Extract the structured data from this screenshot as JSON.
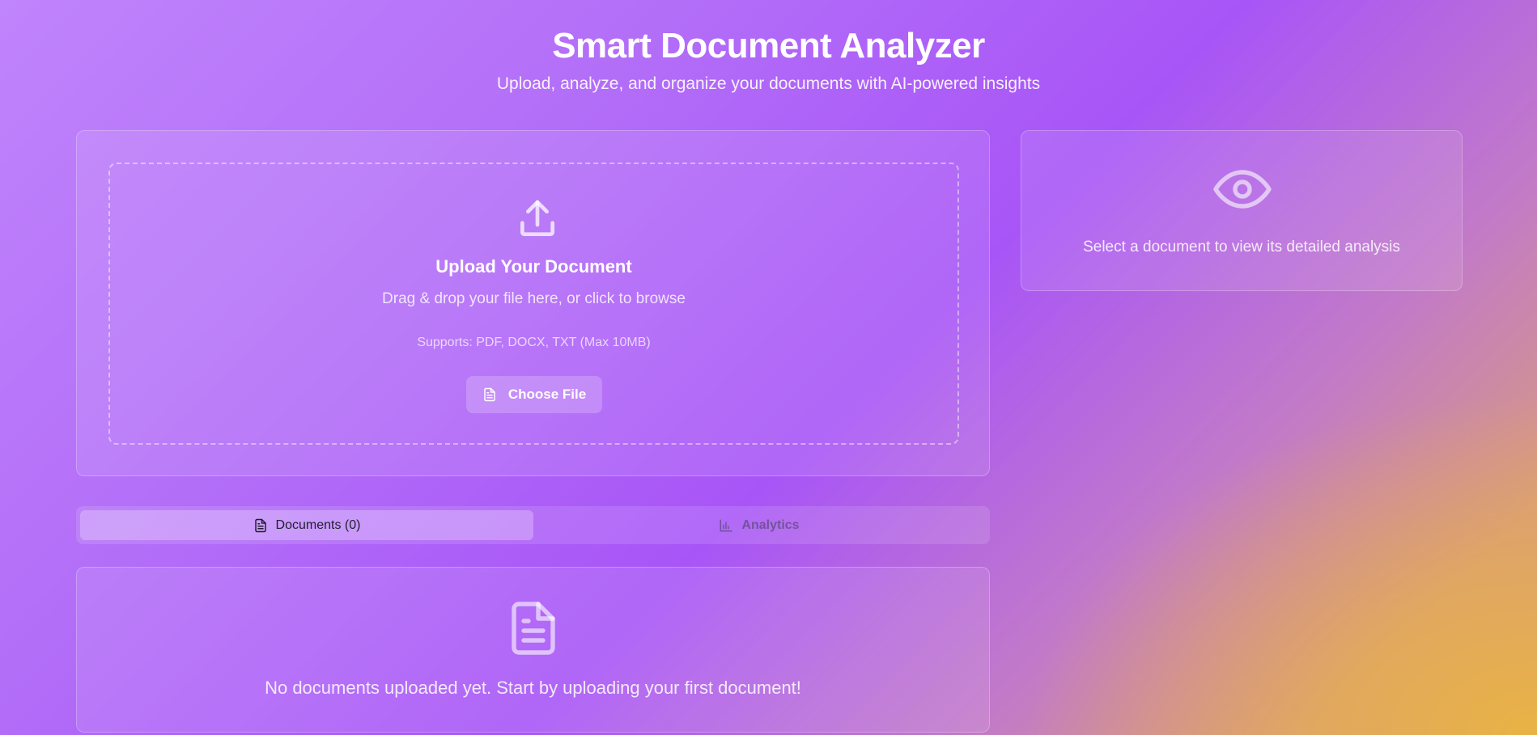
{
  "header": {
    "title": "Smart Document Analyzer",
    "subtitle": "Upload, analyze, and organize your documents with AI-powered insights"
  },
  "upload": {
    "icon": "upload-icon",
    "title": "Upload Your Document",
    "description": "Drag & drop your file here, or click to browse",
    "supports": "Supports: PDF, DOCX, TXT (Max 10MB)",
    "button_label": "Choose File",
    "button_icon": "file-text-icon"
  },
  "preview": {
    "icon": "eye-icon",
    "message": "Select a document to view its detailed analysis"
  },
  "tabs": [
    {
      "label": "Documents (0)",
      "icon": "file-text-icon",
      "active": true
    },
    {
      "label": "Analytics",
      "icon": "bar-chart-icon",
      "active": false
    }
  ],
  "documents": {
    "icon": "file-text-icon",
    "empty_message": "No documents uploaded yet. Start by uploading your first document!"
  }
}
